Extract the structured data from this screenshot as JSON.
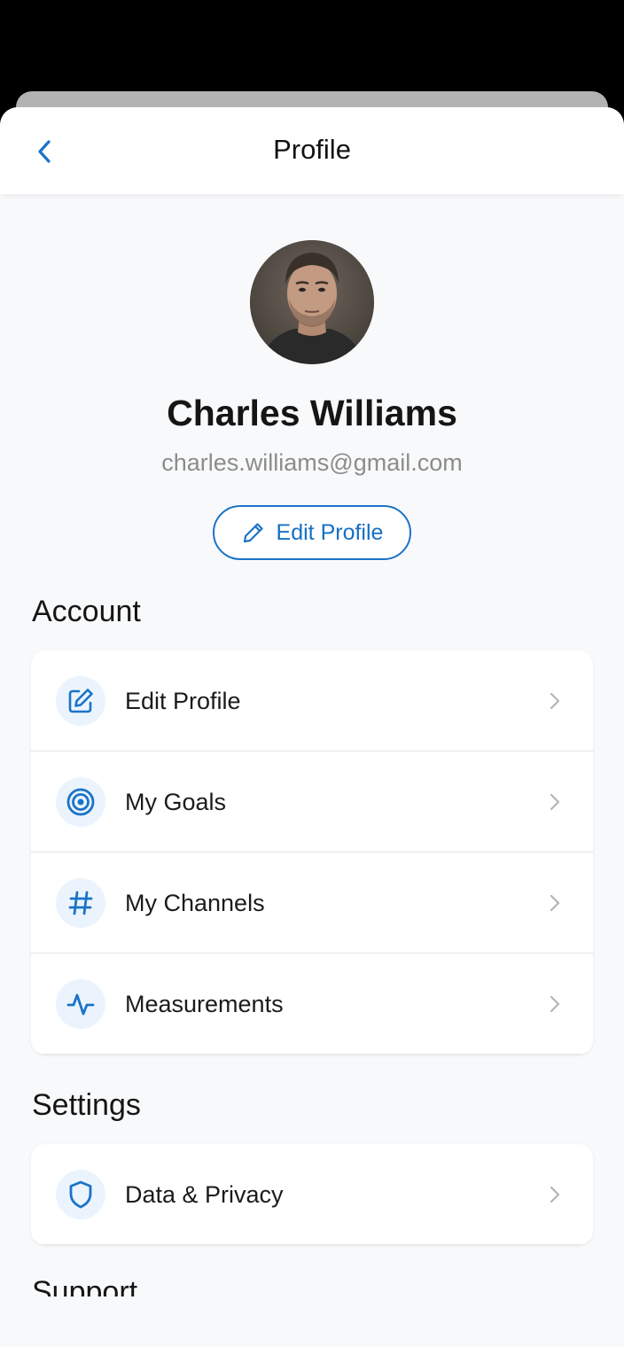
{
  "header": {
    "title": "Profile",
    "back_icon": "chevron-left-icon"
  },
  "profile": {
    "name": "Charles Williams",
    "email": "charles.williams@gmail.com",
    "edit_button_label": "Edit Profile",
    "edit_button_icon": "pencil-icon"
  },
  "sections": {
    "account": {
      "title": "Account",
      "items": [
        {
          "label": "Edit Profile",
          "icon": "edit-square-icon"
        },
        {
          "label": "My Goals",
          "icon": "target-icon"
        },
        {
          "label": "My Channels",
          "icon": "hashtag-icon"
        },
        {
          "label": "Measurements",
          "icon": "activity-pulse-icon"
        }
      ]
    },
    "settings": {
      "title": "Settings",
      "items": [
        {
          "label": "Data & Privacy",
          "icon": "shield-icon"
        }
      ]
    },
    "support": {
      "title": "Support"
    }
  },
  "colors": {
    "accent": "#1a73c8",
    "icon_bg": "#ebf4fd",
    "background": "#f8f9fa"
  }
}
